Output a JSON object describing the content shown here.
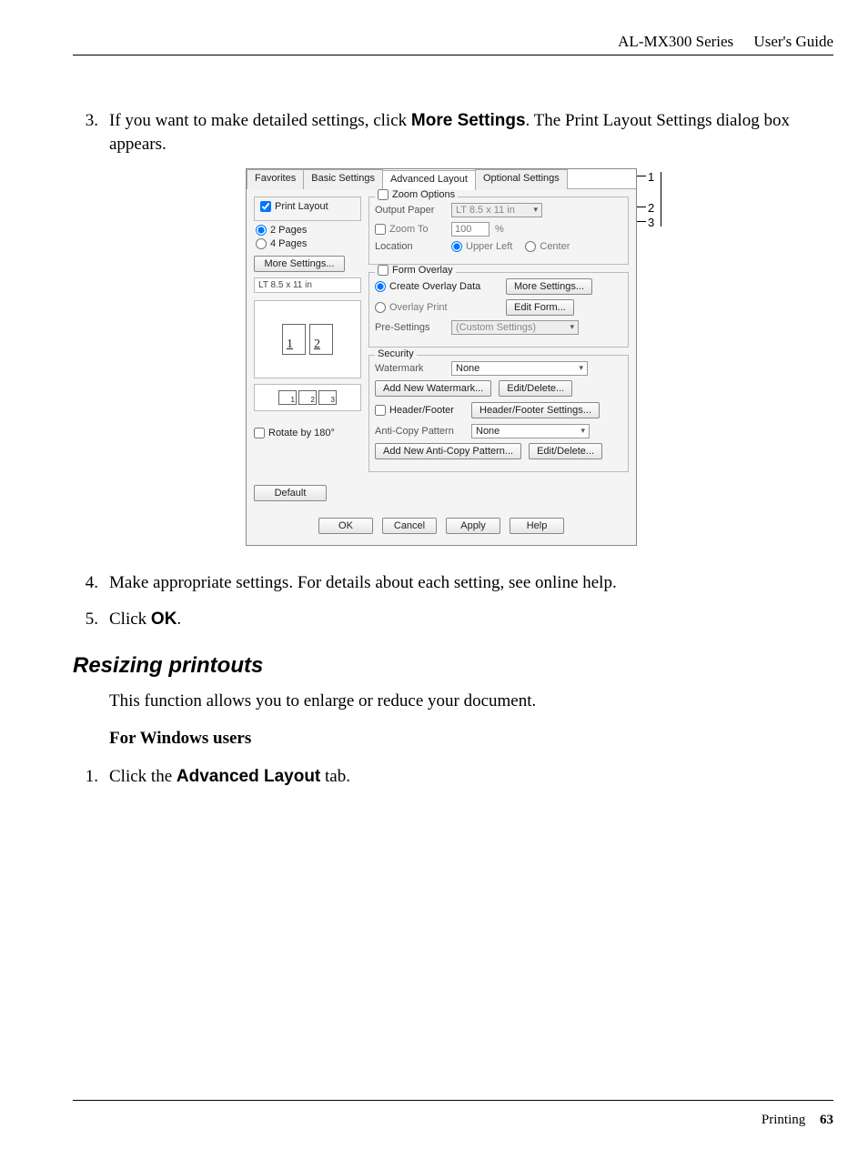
{
  "header": {
    "series": "AL-MX300 Series",
    "guide": "User's Guide"
  },
  "steps": {
    "s3": {
      "num": "3.",
      "pre": "If you want to make detailed settings, click ",
      "bold": "More Settings",
      "post": ". The Print Layout Settings dialog box appears."
    },
    "s4": {
      "num": "4.",
      "text": "Make appropriate settings. For details about each setting, see online help."
    },
    "s5": {
      "num": "5.",
      "pre": "Click ",
      "bold": "OK",
      "post": "."
    }
  },
  "section": {
    "title": "Resizing printouts",
    "intro": "This function allows you to enlarge or reduce your document.",
    "sub": "For Windows users",
    "b1": {
      "num": "1.",
      "pre": "Click the ",
      "bold": "Advanced Layout",
      "post": " tab."
    }
  },
  "dialog": {
    "tabs": {
      "favorites": "Favorites",
      "basic": "Basic Settings",
      "advanced": "Advanced Layout",
      "optional": "Optional Settings"
    },
    "left": {
      "print_layout_chk": "Print Layout",
      "pages2": "2 Pages",
      "pages4": "4 Pages",
      "more_settings": "More Settings...",
      "paper_size": "LT 8.5 x 11 in",
      "preview_1": "1",
      "preview_2": "2",
      "order_1": "1",
      "order_2": "2",
      "order_3": "3",
      "rotate": "Rotate by 180°",
      "default_btn": "Default"
    },
    "zoom": {
      "legend": "Zoom Options",
      "output_paper_lbl": "Output Paper",
      "output_paper_val": "LT 8.5 x 11 in",
      "zoom_to_lbl": "Zoom To",
      "zoom_to_val": "100",
      "zoom_to_pct": "%",
      "location_lbl": "Location",
      "loc_ul": "Upper Left",
      "loc_c": "Center"
    },
    "overlay": {
      "legend": "Form Overlay",
      "create_lbl": "Create Overlay Data",
      "more_btn": "More Settings...",
      "print_lbl": "Overlay Print",
      "edit_btn": "Edit Form...",
      "pre_lbl": "Pre-Settings",
      "pre_val": "(Custom Settings)"
    },
    "security": {
      "legend": "Security",
      "watermark_lbl": "Watermark",
      "watermark_val": "None",
      "add_wm_btn": "Add New Watermark...",
      "wm_edit_btn": "Edit/Delete...",
      "hf_chk": "Header/Footer",
      "hf_btn": "Header/Footer Settings...",
      "acp_lbl": "Anti-Copy Pattern",
      "acp_val": "None",
      "add_acp_btn": "Add New Anti-Copy Pattern...",
      "acp_edit_btn": "Edit/Delete..."
    },
    "buttons": {
      "ok": "OK",
      "cancel": "Cancel",
      "apply": "Apply",
      "help": "Help"
    },
    "annotations": {
      "a1": "1",
      "a2": "2",
      "a3": "3"
    }
  },
  "footer": {
    "section": "Printing",
    "page": "63"
  }
}
